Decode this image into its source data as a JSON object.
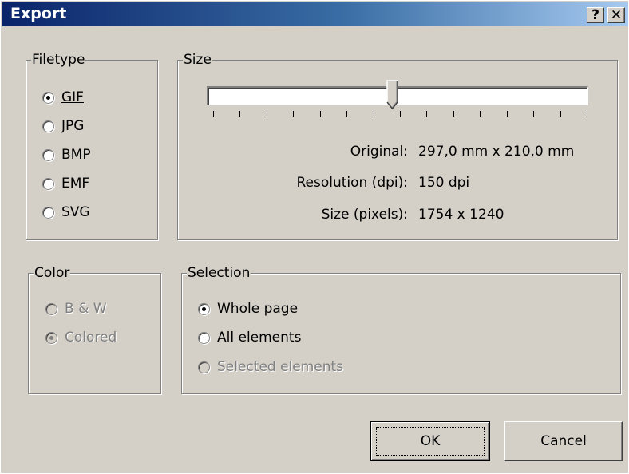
{
  "window": {
    "title": "Export",
    "help_label": "?",
    "close_label": "✕",
    "titlebar_gradient": [
      "#0a246a",
      "#a6caf0"
    ]
  },
  "filetype": {
    "legend": "Filetype",
    "options": [
      {
        "label": "GIF",
        "selected": true
      },
      {
        "label": "JPG",
        "selected": false
      },
      {
        "label": "BMP",
        "selected": false
      },
      {
        "label": "EMF",
        "selected": false
      },
      {
        "label": "SVG",
        "selected": false
      }
    ]
  },
  "size": {
    "legend": "Size",
    "slider_value_fraction": 0.48,
    "tick_count": 15,
    "original_label": "Original:",
    "original_value": "297,0 mm x 210,0 mm",
    "resolution_label": "Resolution (dpi):",
    "resolution_value": "150 dpi",
    "pixels_label": "Size (pixels):",
    "pixels_value": "1754 x 1240"
  },
  "color": {
    "legend": "Color",
    "options": [
      {
        "label": "B & W",
        "selected": false,
        "disabled": true
      },
      {
        "label": "Colored",
        "selected": true,
        "disabled": true
      }
    ]
  },
  "selection": {
    "legend": "Selection",
    "options": [
      {
        "label": "Whole page",
        "selected": true,
        "disabled": false
      },
      {
        "label": "All elements",
        "selected": false,
        "disabled": false
      },
      {
        "label": "Selected elements",
        "selected": false,
        "disabled": true
      }
    ]
  },
  "buttons": {
    "ok_label": "OK",
    "cancel_label": "Cancel"
  }
}
